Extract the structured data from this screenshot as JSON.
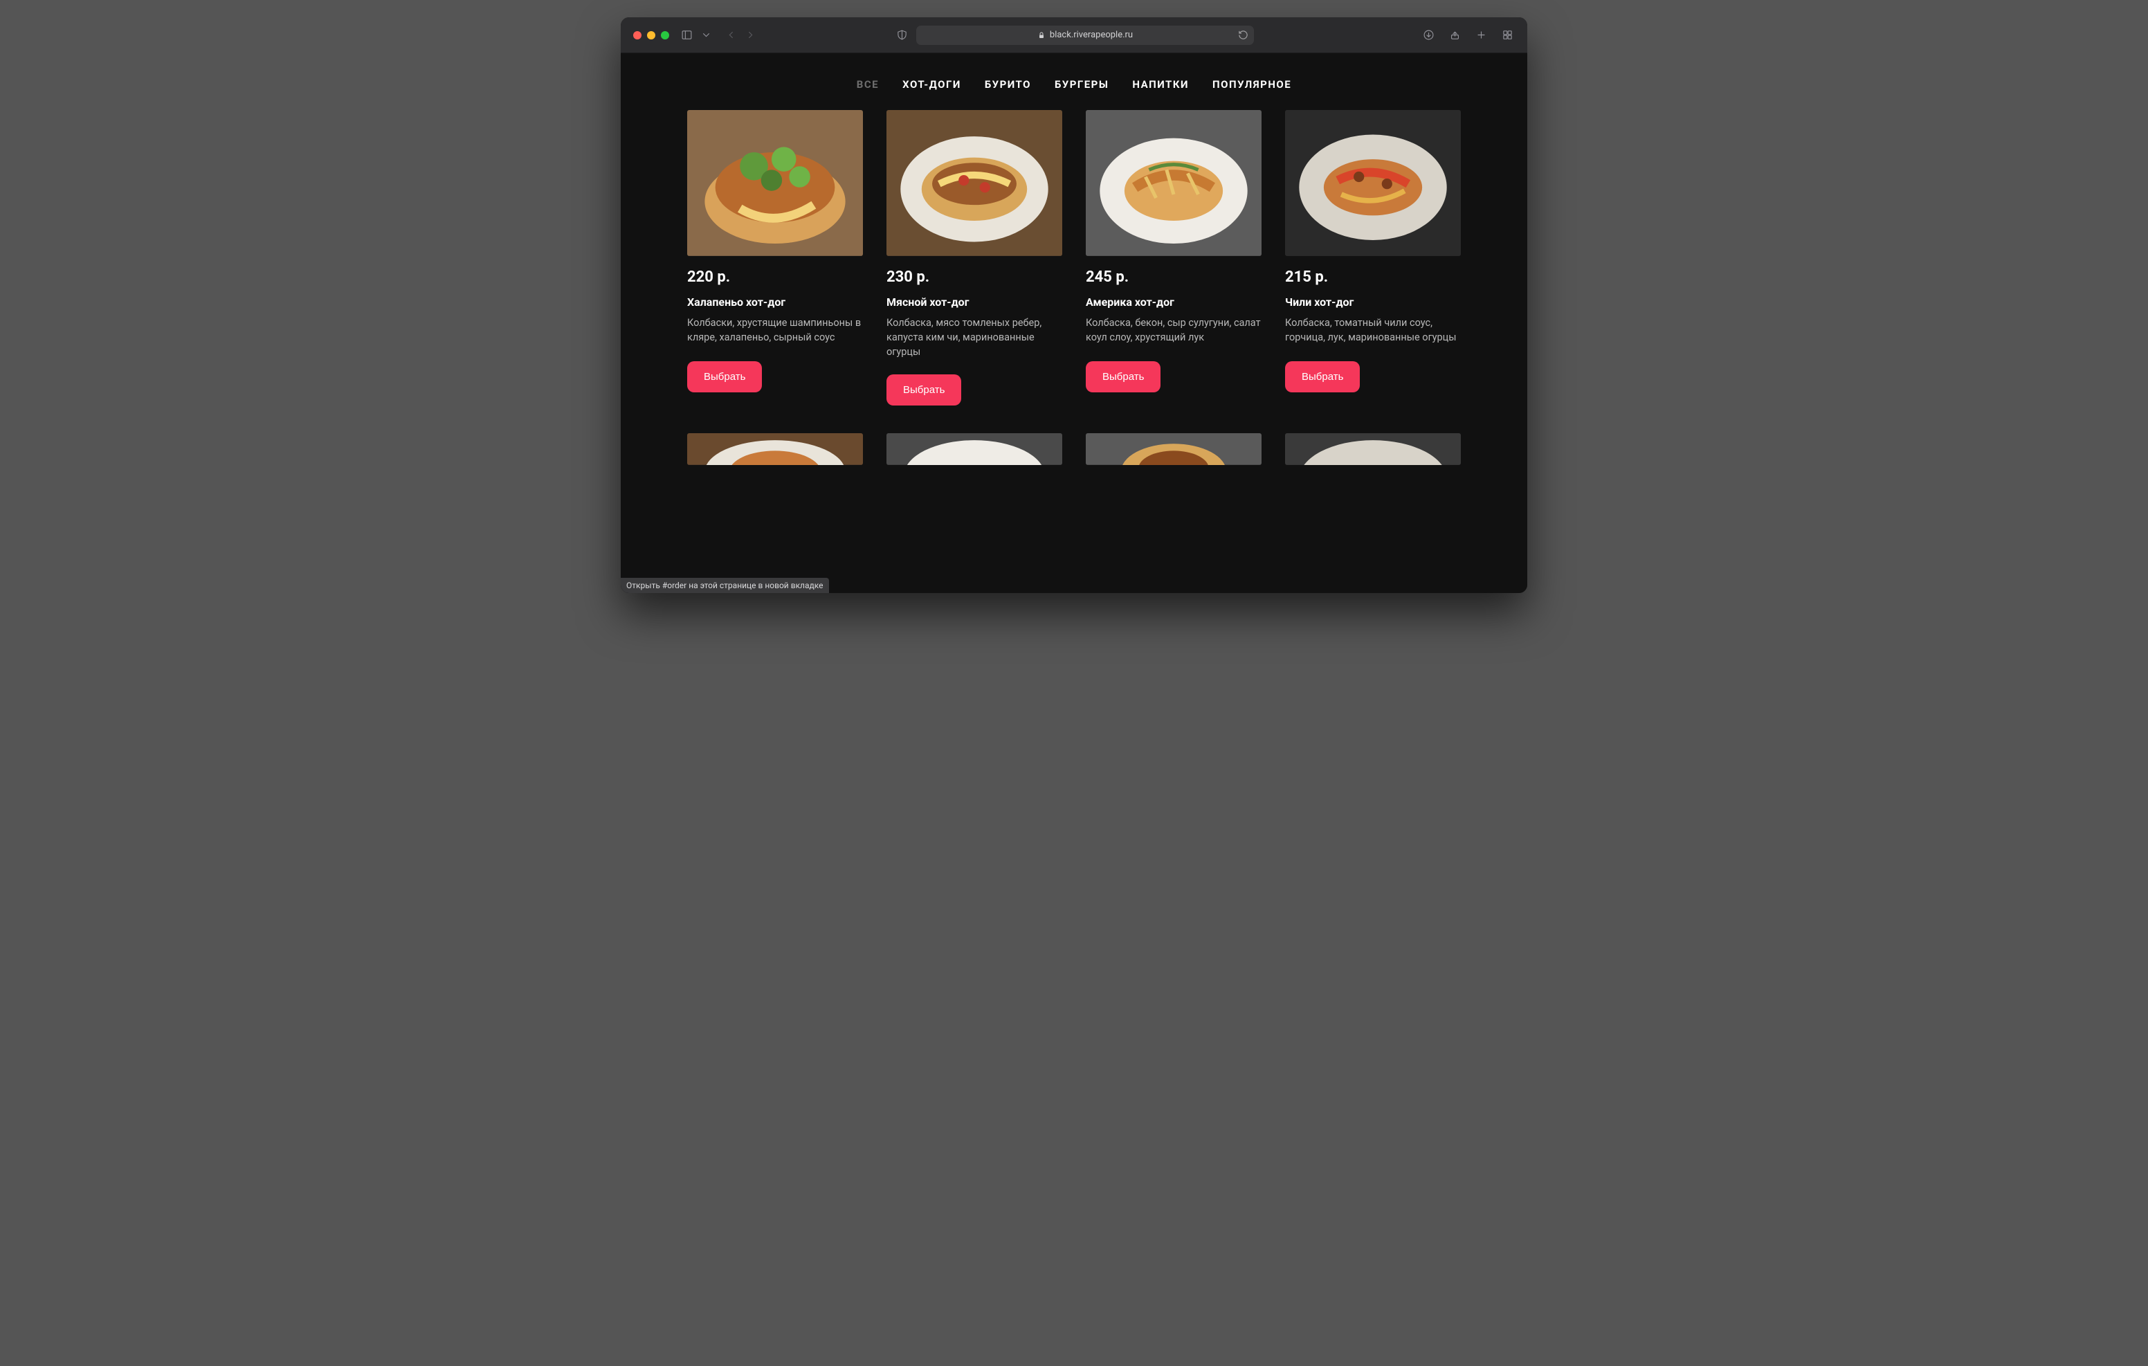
{
  "browser": {
    "url_display": "black.riverapeople.ru",
    "status_tip": "Открыть #order на этой странице в новой вкладке"
  },
  "nav": {
    "items": [
      {
        "label": "ВСЕ",
        "active": true
      },
      {
        "label": "ХОТ-ДОГИ",
        "active": false
      },
      {
        "label": "БУРИТО",
        "active": false
      },
      {
        "label": "БУРГЕРЫ",
        "active": false
      },
      {
        "label": "НАПИТКИ",
        "active": false
      },
      {
        "label": "ПОПУЛЯРНОЕ",
        "active": false
      }
    ]
  },
  "products": [
    {
      "price": "220 р.",
      "title": "Халапеньо хот-дог",
      "desc": "Колбаски, хрустящие шампиньоны в кляре, халапеньо, сырный соус",
      "cta": "Выбрать"
    },
    {
      "price": "230 р.",
      "title": "Мясной хот-дог",
      "desc": "Колбаска, мясо томленых ребер, капуста ким чи, маринованные огурцы",
      "cta": "Выбрать"
    },
    {
      "price": "245 р.",
      "title": "Америка хот-дог",
      "desc": "Колбаска, бекон, сыр сулугуни, салат коул слоу, хрустящий лук",
      "cta": "Выбрать"
    },
    {
      "price": "215 р.",
      "title": "Чили хот-дог",
      "desc": "Колбаска, томатный чили соус, горчица, лук, маринованные огурцы",
      "cta": "Выбрать"
    }
  ]
}
